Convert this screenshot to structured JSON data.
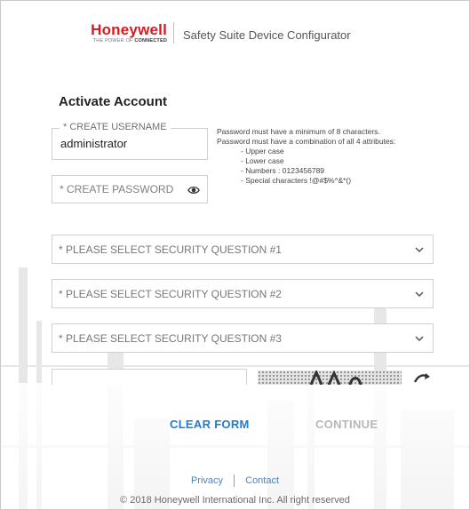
{
  "header": {
    "logo_word": "Honeywell",
    "logo_tagline_prefix": "THE POWER OF",
    "logo_tagline_strong": "CONNECTED",
    "app_title": "Safety Suite Device Configurator"
  },
  "form": {
    "section_title": "Activate Account",
    "username": {
      "label": "* CREATE USERNAME",
      "value": "administrator"
    },
    "password": {
      "placeholder": "* CREATE PASSWORD",
      "icon": "eye-icon"
    },
    "password_rules": {
      "line1": "Password must have a minimum of 8 characters.",
      "line2": "Password must have a combination of all 4 attributes:",
      "items": [
        "- Upper case",
        "- Lower case",
        "- Numbers : 0123456789",
        "- Special characters !@#$%^&*()"
      ]
    },
    "security_questions": [
      "* PLEASE SELECT SECURITY QUESTION #1",
      "* PLEASE SELECT SECURITY QUESTION #2",
      "* PLEASE SELECT SECURITY QUESTION #3"
    ],
    "captcha_refresh_icon": "refresh-arrow-icon"
  },
  "actions": {
    "clear_label": "CLEAR FORM",
    "continue_label": "CONTINUE"
  },
  "footer": {
    "privacy": "Privacy",
    "contact": "Contact",
    "copyright": "© 2018 Honeywell International Inc. All right reserved"
  },
  "colors": {
    "brand_red": "#d71920",
    "link_blue": "#1f7bd4",
    "disabled_gray": "#b7b7b7"
  }
}
